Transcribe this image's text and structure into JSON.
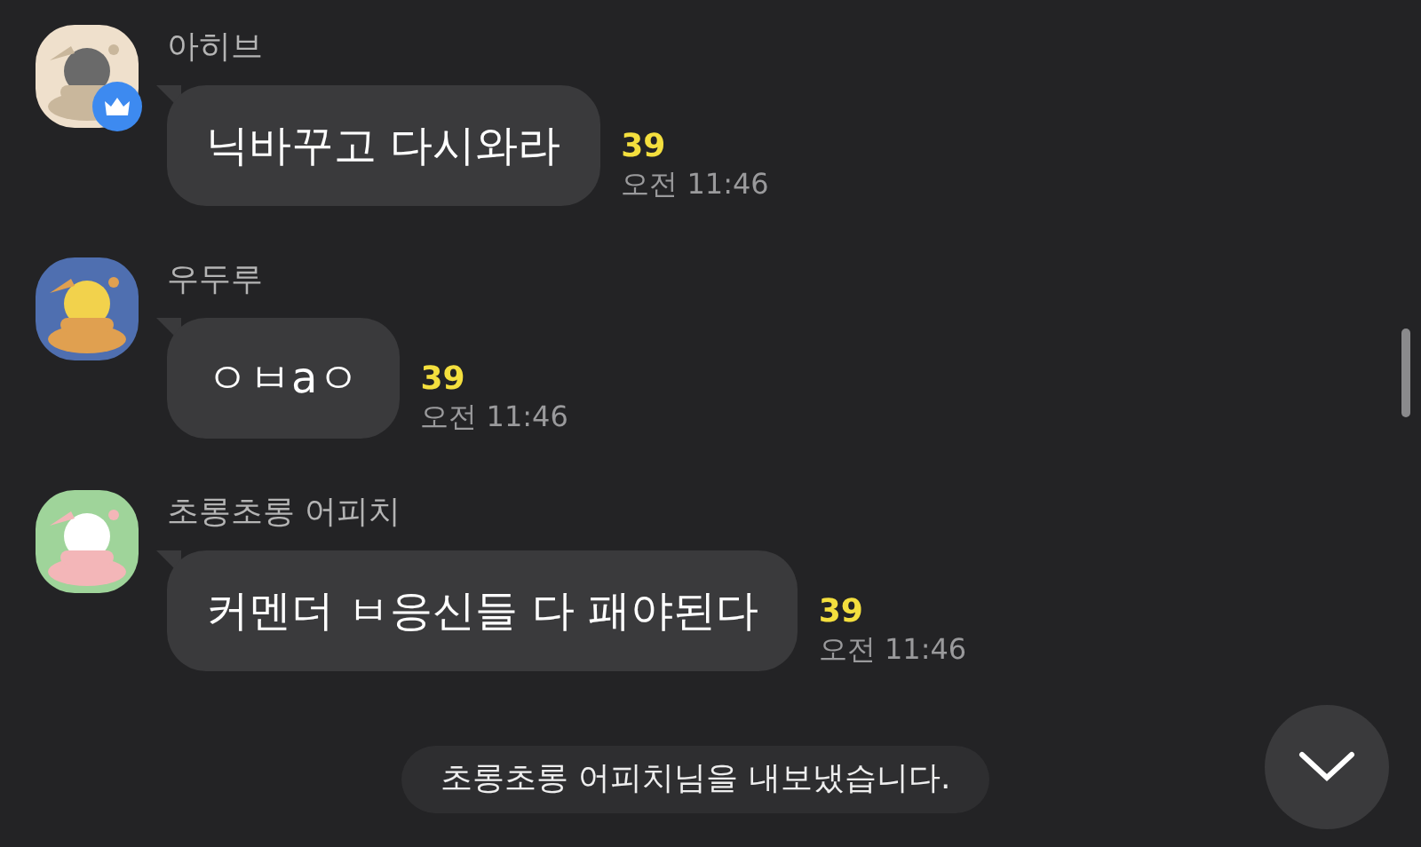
{
  "messages": [
    {
      "sender": "아히브",
      "host": true,
      "text": "닉바꾸고 다시와라",
      "unread": "39",
      "time": "오전 11:46"
    },
    {
      "sender": "우두루",
      "host": false,
      "text": "ㅇㅂaㅇ",
      "unread": "39",
      "time": "오전 11:46"
    },
    {
      "sender": "초롱초롱 어피치",
      "host": false,
      "text": "커멘더 ㅂ응신들 다 패야된다",
      "unread": "39",
      "time": "오전 11:46"
    }
  ],
  "notice": "초롱초롱 어피치님을 내보냈습니다."
}
